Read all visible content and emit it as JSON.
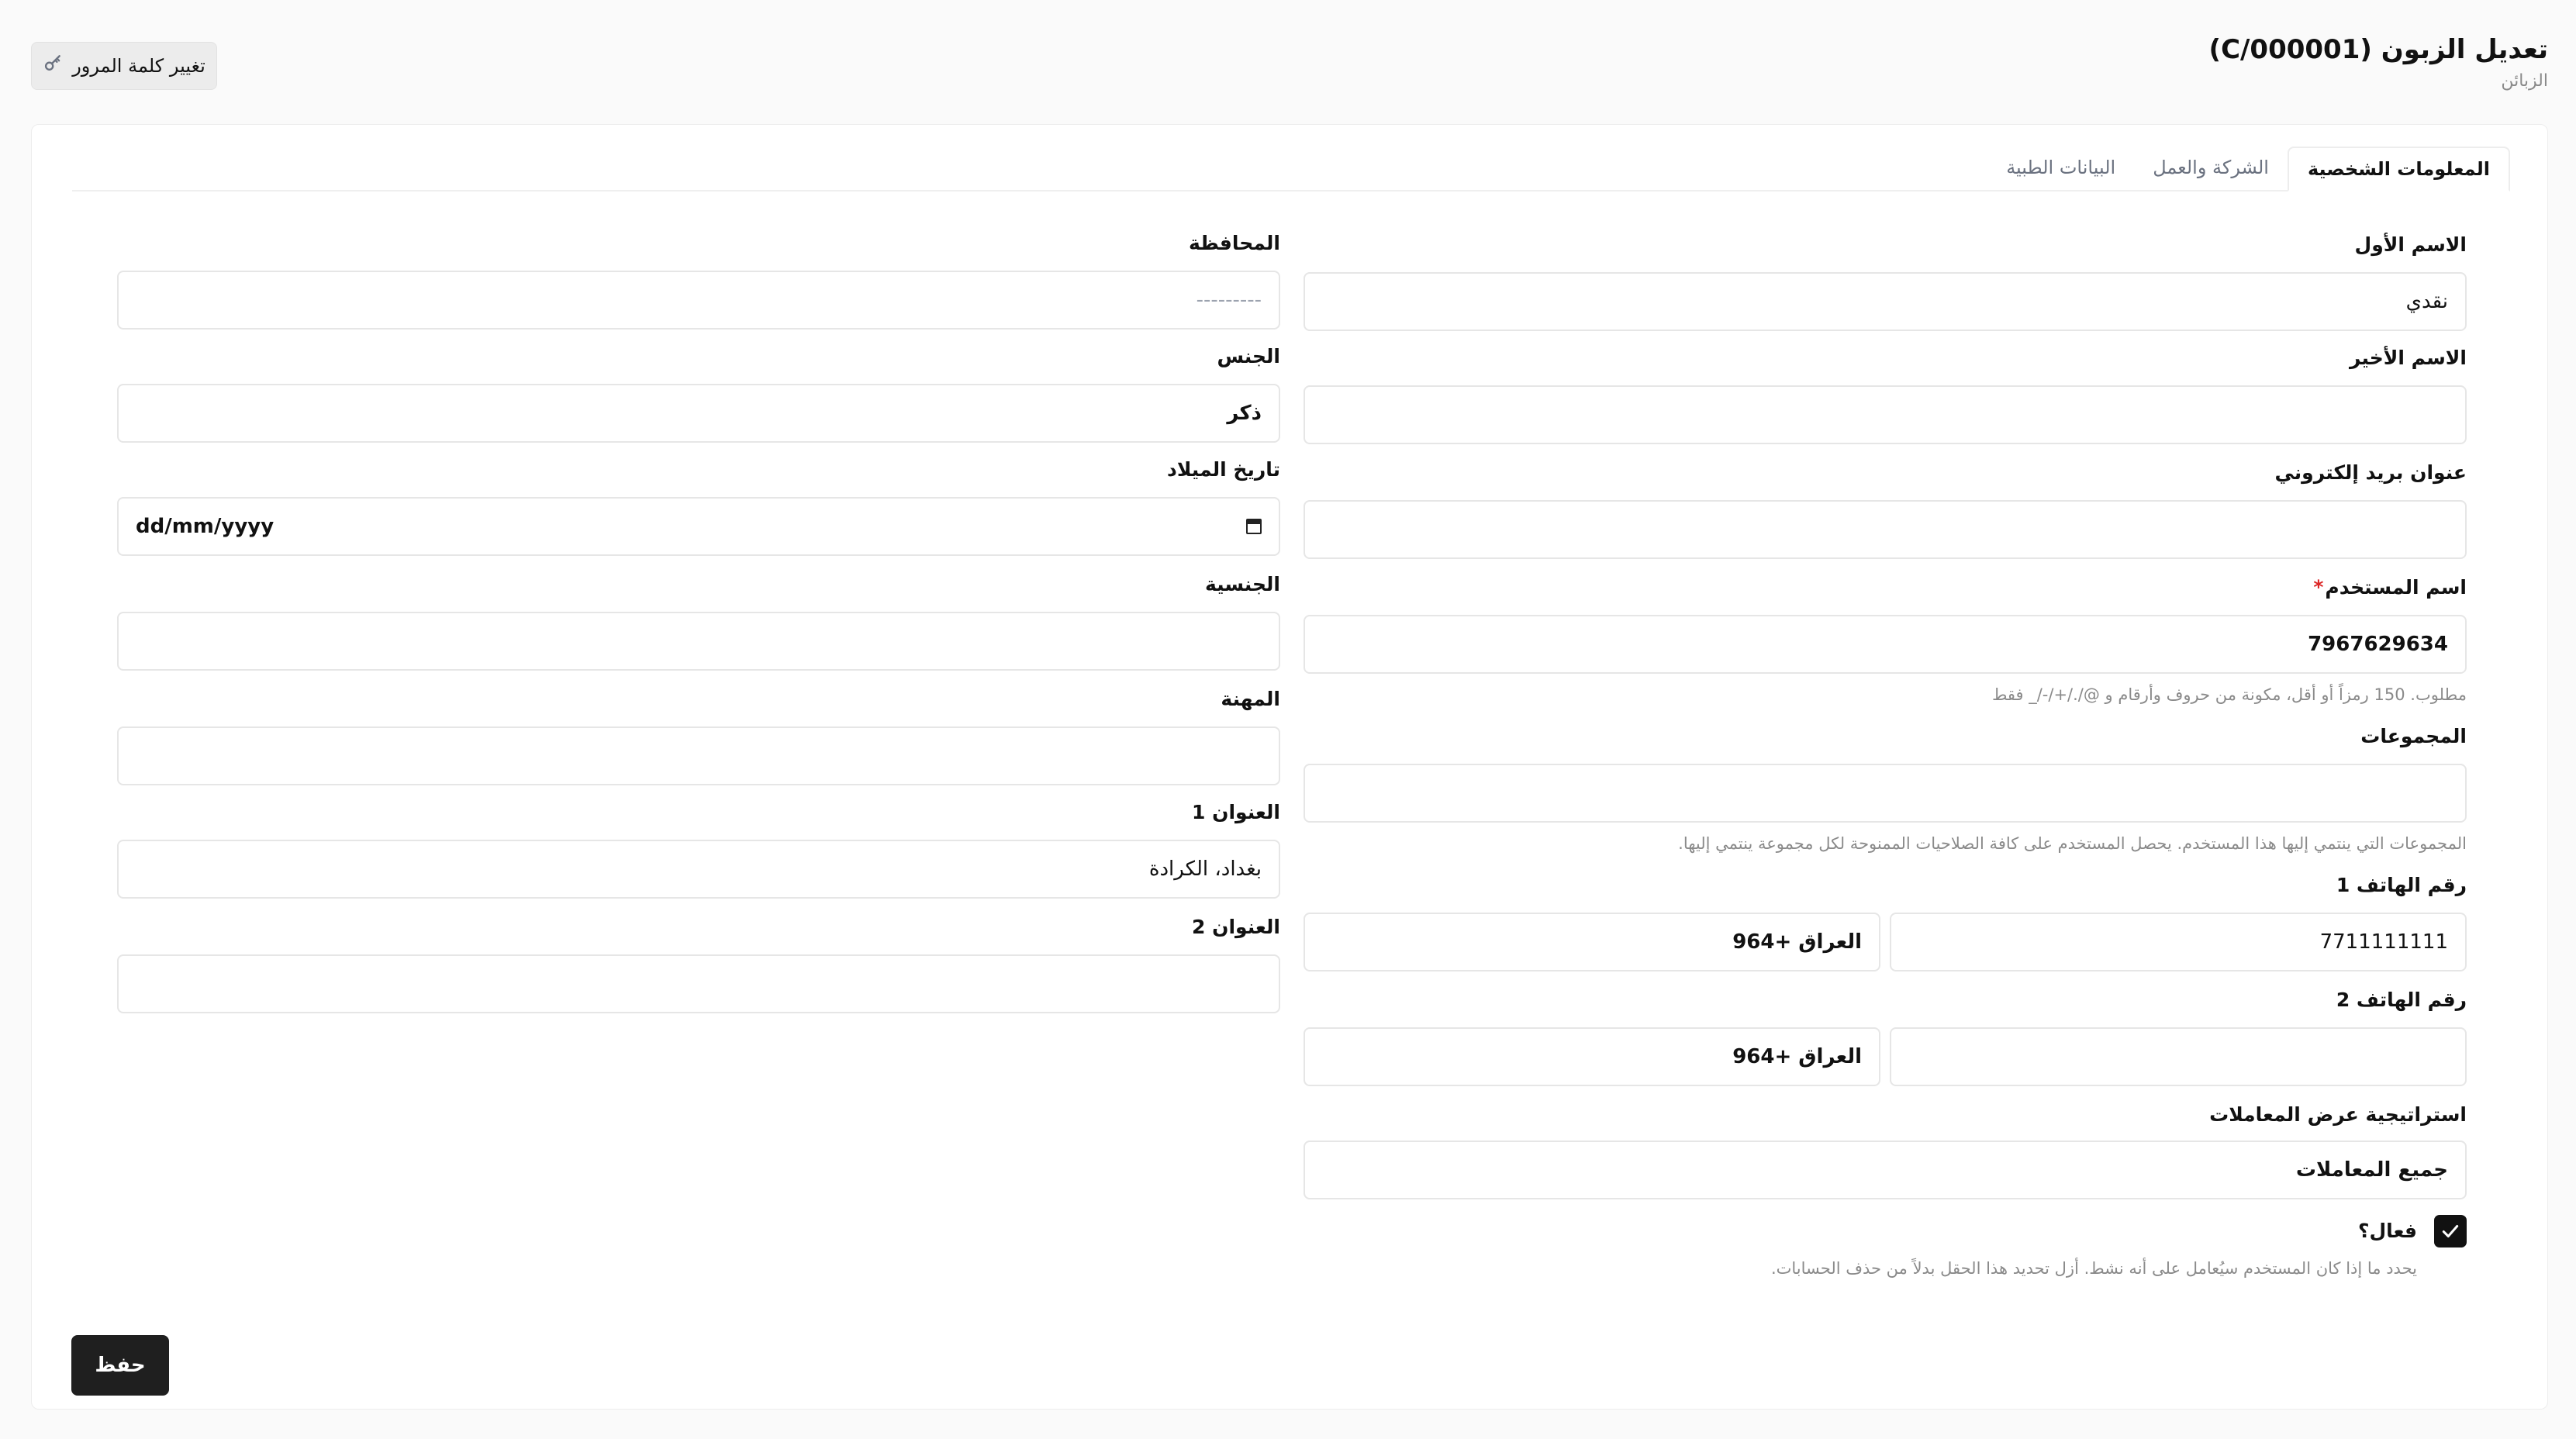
{
  "header": {
    "title": "تعديل الزبون (C/000001)",
    "breadcrumb": "الزبائن",
    "change_password_label": "تغيير كلمة المرور",
    "change_password_icon": "key-icon"
  },
  "tabs": [
    {
      "label": "المعلومات الشخصية",
      "active": true
    },
    {
      "label": "الشركة والعمل",
      "active": false
    },
    {
      "label": "البيانات الطبية",
      "active": false
    }
  ],
  "form": {
    "first_name": {
      "label": "الاسم الأول",
      "value": "نقدي"
    },
    "last_name": {
      "label": "الاسم الأخير",
      "value": ""
    },
    "email": {
      "label": "عنوان بريد إلكتروني",
      "value": ""
    },
    "username": {
      "label": "اسم المستخدم",
      "required_mark": "*",
      "value": "7967629634",
      "help": "مطلوب. 150 رمزاً أو أقل، مكونة من حروف وأرقام و @/./+/-/_ فقط"
    },
    "groups": {
      "label": "المجموعات",
      "value": "",
      "help": "المجموعات التي ينتمي إليها هذا المستخدم. يحصل المستخدم على كافة الصلاحيات الممنوحة لكل مجموعة ينتمي إليها."
    },
    "phone1": {
      "label": "رقم الهاتف 1",
      "number": "7711111111",
      "country": "العراق +964"
    },
    "phone2": {
      "label": "رقم الهاتف 2",
      "number": "",
      "country": "العراق +964"
    },
    "transactions_strategy": {
      "label": "استراتيجية عرض المعاملات",
      "value": "جميع المعاملات"
    },
    "is_active": {
      "label": "فعال؟",
      "checked": true,
      "help": "يحدد ما إذا كان المستخدم سيُعامل على أنه نشط. أزل تحديد هذا الحقل بدلاً من حذف الحسابات."
    },
    "governorate": {
      "label": "المحافظة",
      "placeholder": "---------"
    },
    "gender": {
      "label": "الجنس",
      "value": "ذكر"
    },
    "birth_date": {
      "label": "تاريخ الميلاد",
      "placeholder": "dd/mm/yyyy",
      "icon": "calendar-icon"
    },
    "nationality": {
      "label": "الجنسية",
      "value": ""
    },
    "profession": {
      "label": "المهنة",
      "value": ""
    },
    "address1": {
      "label": "العنوان 1",
      "value": "بغداد، الكرادة"
    },
    "address2": {
      "label": "العنوان 2",
      "value": ""
    }
  },
  "actions": {
    "save_label": "حفظ"
  },
  "colors": {
    "primary_button": "#1f1f1f",
    "required": "#dc2626",
    "page_bg": "#fafafa"
  }
}
